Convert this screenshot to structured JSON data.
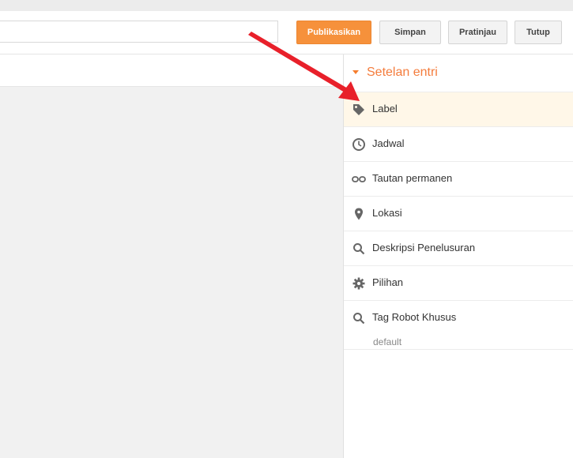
{
  "toolbar": {
    "publish_label": "Publikasikan",
    "save_label": "Simpan",
    "preview_label": "Pratinjau",
    "close_label": "Tutup"
  },
  "sidebar": {
    "title": "Setelan entri",
    "items": [
      {
        "label": "Label",
        "icon": "tag-icon"
      },
      {
        "label": "Jadwal",
        "icon": "clock-icon"
      },
      {
        "label": "Tautan permanen",
        "icon": "link-icon"
      },
      {
        "label": "Lokasi",
        "icon": "map-pin-icon"
      },
      {
        "label": "Deskripsi Penelusuran",
        "icon": "search-icon"
      },
      {
        "label": "Pilihan",
        "icon": "gear-icon"
      },
      {
        "label": "Tag Robot Khusus",
        "icon": "search-icon",
        "sub": "default"
      }
    ]
  },
  "colors": {
    "accent": "#f6913b",
    "active_row": "#fff7e8",
    "annotation_arrow": "#e8202a"
  }
}
